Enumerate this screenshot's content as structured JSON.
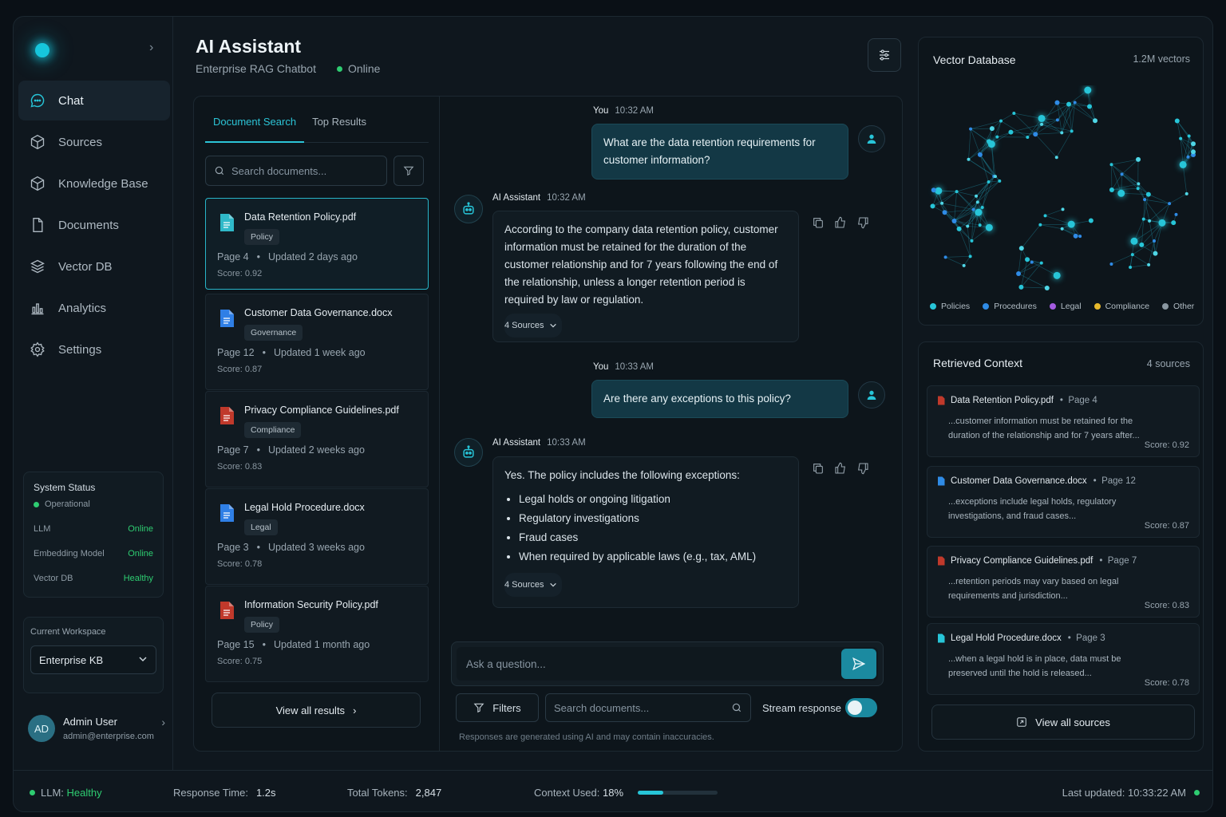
{
  "sidebar": {
    "nav": [
      {
        "label": "Chat",
        "icon": "chat-icon"
      },
      {
        "label": "Sources",
        "icon": "sources-icon"
      },
      {
        "label": "Knowledge Base",
        "icon": "knowledge-base-icon"
      },
      {
        "label": "Documents",
        "icon": "document-icon"
      },
      {
        "label": "Vector DB",
        "icon": "database-icon"
      },
      {
        "label": "Analytics",
        "icon": "analytics-icon"
      },
      {
        "label": "Settings",
        "icon": "gear-icon"
      }
    ],
    "system_status": {
      "title": "System Status",
      "state": "Operational",
      "rows": [
        {
          "label": "LLM",
          "value": "Online"
        },
        {
          "label": "Embedding Model",
          "value": "Online"
        },
        {
          "label": "Vector DB",
          "value": "Healthy"
        }
      ]
    },
    "workspace": {
      "label": "Current Workspace",
      "value": "Enterprise KB"
    },
    "user": {
      "initials": "AD",
      "name": "Admin User",
      "email": "admin@enterprise.com"
    }
  },
  "header": {
    "title": "AI Assistant",
    "subtitle": "Enterprise RAG Chatbot",
    "status": "Online"
  },
  "doc_panel": {
    "tabs": [
      "Document Search",
      "Top Results"
    ],
    "search_placeholder": "Search documents...",
    "results": [
      {
        "name": "Data Retention Policy.pdf",
        "tag": "Policy",
        "page": "Page 4",
        "updated": "Updated 2 days ago",
        "score": "Score: 0.92",
        "type": "sheet"
      },
      {
        "name": "Customer Data Governance.docx",
        "tag": "Governance",
        "page": "Page 12",
        "updated": "Updated 1 week ago",
        "score": "Score: 0.87",
        "type": "doc"
      },
      {
        "name": "Privacy Compliance Guidelines.pdf",
        "tag": "Compliance",
        "page": "Page 7",
        "updated": "Updated 2 weeks ago",
        "score": "Score: 0.83",
        "type": "pdf"
      },
      {
        "name": "Legal Hold Procedure.docx",
        "tag": "Legal",
        "page": "Page 3",
        "updated": "Updated 3 weeks ago",
        "score": "Score: 0.78",
        "type": "doc"
      },
      {
        "name": "Information Security Policy.pdf",
        "tag": "Policy",
        "page": "Page 15",
        "updated": "Updated 1 month ago",
        "score": "Score: 0.75",
        "type": "pdf"
      }
    ],
    "view_all": "View all results"
  },
  "chat": {
    "messages": [
      {
        "role": "You",
        "time": "10:32 AM",
        "text": "What are the data retention requirements for customer information?"
      },
      {
        "role": "AI Assistant",
        "time": "10:32 AM",
        "text": "According to the company data retention policy, customer information must be retained for the duration of the customer relationship and for 7 years following the end of the relationship, unless a longer retention period is required by law or regulation.",
        "sources": "4 Sources"
      },
      {
        "role": "You",
        "time": "10:33 AM",
        "text": "Are there any exceptions to this policy?"
      },
      {
        "role": "AI Assistant",
        "time": "10:33 AM",
        "text": "Yes. The policy includes the following exceptions:",
        "bullets": [
          "Legal holds or ongoing litigation",
          "Regulatory investigations",
          "Fraud cases",
          "When required by applicable laws (e.g., tax, AML)"
        ],
        "sources": "4 Sources"
      }
    ],
    "input_placeholder": "Ask a question...",
    "filters_label": "Filters",
    "search_placeholder": "Search documents...",
    "stream_label": "Stream response",
    "stream_on": true,
    "disclaimer": "Responses are generated using AI and may contain inaccuracies."
  },
  "vector_db": {
    "title": "Vector Database",
    "count": "1.2M vectors",
    "legend": [
      {
        "label": "Policies",
        "color": "#27c5d8"
      },
      {
        "label": "Procedures",
        "color": "#2f8be6"
      },
      {
        "label": "Legal",
        "color": "#a45be0"
      },
      {
        "label": "Compliance",
        "color": "#e7b92c"
      },
      {
        "label": "Other",
        "color": "#8a97a1"
      }
    ]
  },
  "retrieved_context": {
    "title": "Retrieved Context",
    "count": "4 sources",
    "items": [
      {
        "name": "Data Retention Policy.pdf",
        "page": "Page 4",
        "excerpt": "...customer information must be retained for the duration of the relationship and for 7 years after...",
        "score": "Score: 0.92",
        "color": "#c0392b"
      },
      {
        "name": "Customer Data Governance.docx",
        "page": "Page 12",
        "excerpt": "...exceptions include legal holds, regulatory investigations, and fraud cases...",
        "score": "Score: 0.87",
        "color": "#2f8be6"
      },
      {
        "name": "Privacy Compliance Guidelines.pdf",
        "page": "Page 7",
        "excerpt": "...retention periods may vary based on legal requirements and jurisdiction...",
        "score": "Score: 0.83",
        "color": "#c0392b"
      },
      {
        "name": "Legal Hold Procedure.docx",
        "page": "Page 3",
        "excerpt": "...when a legal hold is in place, data must be preserved until the hold is released...",
        "score": "Score: 0.78",
        "color": "#27c5d8"
      }
    ],
    "view_all": "View all sources"
  },
  "footer": {
    "llm_label": "LLM:",
    "llm_value": "Healthy",
    "response_label": "Response Time:",
    "response_value": "1.2s",
    "tokens_label": "Total Tokens:",
    "tokens_value": "2,847",
    "context_label": "Context Used:",
    "context_value": "18%",
    "context_fraction": 0.32,
    "updated": "Last updated: 10:33:22 AM"
  }
}
